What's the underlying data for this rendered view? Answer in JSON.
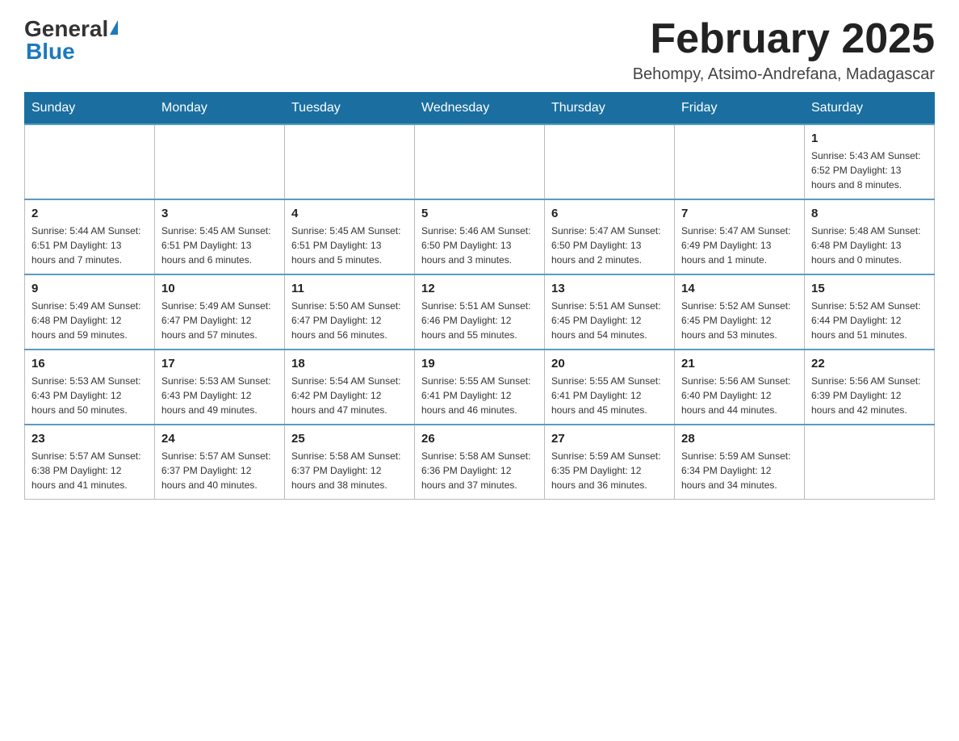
{
  "header": {
    "logo_general": "General",
    "logo_blue": "Blue",
    "month_title": "February 2025",
    "location": "Behompy, Atsimo-Andrefana, Madagascar"
  },
  "weekdays": [
    "Sunday",
    "Monday",
    "Tuesday",
    "Wednesday",
    "Thursday",
    "Friday",
    "Saturday"
  ],
  "weeks": [
    [
      {
        "day": "",
        "info": ""
      },
      {
        "day": "",
        "info": ""
      },
      {
        "day": "",
        "info": ""
      },
      {
        "day": "",
        "info": ""
      },
      {
        "day": "",
        "info": ""
      },
      {
        "day": "",
        "info": ""
      },
      {
        "day": "1",
        "info": "Sunrise: 5:43 AM\nSunset: 6:52 PM\nDaylight: 13 hours and 8 minutes."
      }
    ],
    [
      {
        "day": "2",
        "info": "Sunrise: 5:44 AM\nSunset: 6:51 PM\nDaylight: 13 hours and 7 minutes."
      },
      {
        "day": "3",
        "info": "Sunrise: 5:45 AM\nSunset: 6:51 PM\nDaylight: 13 hours and 6 minutes."
      },
      {
        "day": "4",
        "info": "Sunrise: 5:45 AM\nSunset: 6:51 PM\nDaylight: 13 hours and 5 minutes."
      },
      {
        "day": "5",
        "info": "Sunrise: 5:46 AM\nSunset: 6:50 PM\nDaylight: 13 hours and 3 minutes."
      },
      {
        "day": "6",
        "info": "Sunrise: 5:47 AM\nSunset: 6:50 PM\nDaylight: 13 hours and 2 minutes."
      },
      {
        "day": "7",
        "info": "Sunrise: 5:47 AM\nSunset: 6:49 PM\nDaylight: 13 hours and 1 minute."
      },
      {
        "day": "8",
        "info": "Sunrise: 5:48 AM\nSunset: 6:48 PM\nDaylight: 13 hours and 0 minutes."
      }
    ],
    [
      {
        "day": "9",
        "info": "Sunrise: 5:49 AM\nSunset: 6:48 PM\nDaylight: 12 hours and 59 minutes."
      },
      {
        "day": "10",
        "info": "Sunrise: 5:49 AM\nSunset: 6:47 PM\nDaylight: 12 hours and 57 minutes."
      },
      {
        "day": "11",
        "info": "Sunrise: 5:50 AM\nSunset: 6:47 PM\nDaylight: 12 hours and 56 minutes."
      },
      {
        "day": "12",
        "info": "Sunrise: 5:51 AM\nSunset: 6:46 PM\nDaylight: 12 hours and 55 minutes."
      },
      {
        "day": "13",
        "info": "Sunrise: 5:51 AM\nSunset: 6:45 PM\nDaylight: 12 hours and 54 minutes."
      },
      {
        "day": "14",
        "info": "Sunrise: 5:52 AM\nSunset: 6:45 PM\nDaylight: 12 hours and 53 minutes."
      },
      {
        "day": "15",
        "info": "Sunrise: 5:52 AM\nSunset: 6:44 PM\nDaylight: 12 hours and 51 minutes."
      }
    ],
    [
      {
        "day": "16",
        "info": "Sunrise: 5:53 AM\nSunset: 6:43 PM\nDaylight: 12 hours and 50 minutes."
      },
      {
        "day": "17",
        "info": "Sunrise: 5:53 AM\nSunset: 6:43 PM\nDaylight: 12 hours and 49 minutes."
      },
      {
        "day": "18",
        "info": "Sunrise: 5:54 AM\nSunset: 6:42 PM\nDaylight: 12 hours and 47 minutes."
      },
      {
        "day": "19",
        "info": "Sunrise: 5:55 AM\nSunset: 6:41 PM\nDaylight: 12 hours and 46 minutes."
      },
      {
        "day": "20",
        "info": "Sunrise: 5:55 AM\nSunset: 6:41 PM\nDaylight: 12 hours and 45 minutes."
      },
      {
        "day": "21",
        "info": "Sunrise: 5:56 AM\nSunset: 6:40 PM\nDaylight: 12 hours and 44 minutes."
      },
      {
        "day": "22",
        "info": "Sunrise: 5:56 AM\nSunset: 6:39 PM\nDaylight: 12 hours and 42 minutes."
      }
    ],
    [
      {
        "day": "23",
        "info": "Sunrise: 5:57 AM\nSunset: 6:38 PM\nDaylight: 12 hours and 41 minutes."
      },
      {
        "day": "24",
        "info": "Sunrise: 5:57 AM\nSunset: 6:37 PM\nDaylight: 12 hours and 40 minutes."
      },
      {
        "day": "25",
        "info": "Sunrise: 5:58 AM\nSunset: 6:37 PM\nDaylight: 12 hours and 38 minutes."
      },
      {
        "day": "26",
        "info": "Sunrise: 5:58 AM\nSunset: 6:36 PM\nDaylight: 12 hours and 37 minutes."
      },
      {
        "day": "27",
        "info": "Sunrise: 5:59 AM\nSunset: 6:35 PM\nDaylight: 12 hours and 36 minutes."
      },
      {
        "day": "28",
        "info": "Sunrise: 5:59 AM\nSunset: 6:34 PM\nDaylight: 12 hours and 34 minutes."
      },
      {
        "day": "",
        "info": ""
      }
    ]
  ]
}
